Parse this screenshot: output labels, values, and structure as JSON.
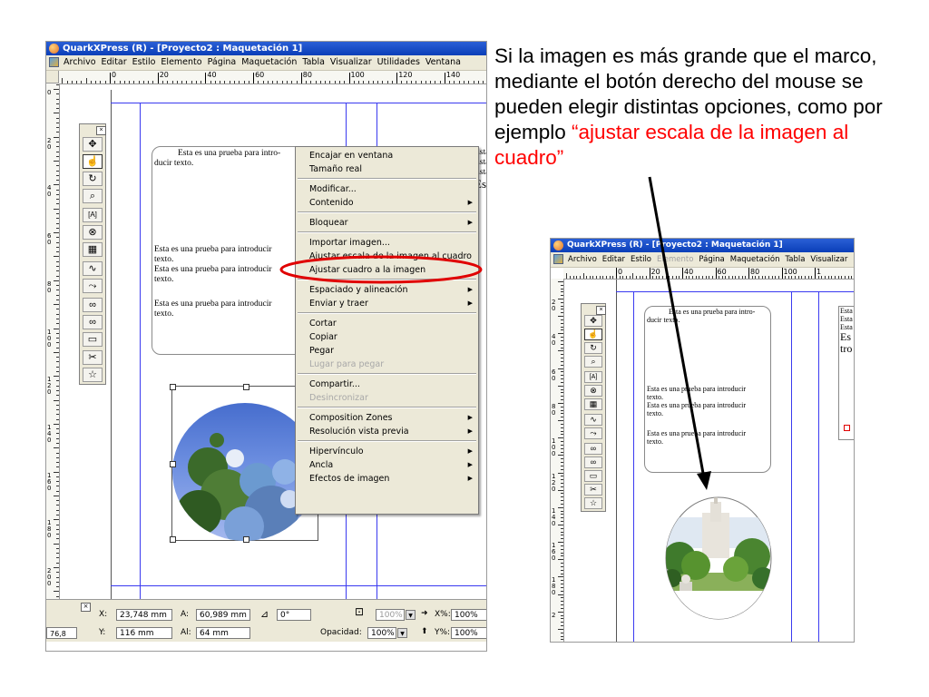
{
  "window": {
    "title": "QuarkXPress (R) - [Proyecto2 : Maquetación 1]"
  },
  "menubar": [
    "Archivo",
    "Editar",
    "Estilo",
    "Elemento",
    "Página",
    "Maquetación",
    "Tabla",
    "Visualizar",
    "Utilidades",
    "Ventana"
  ],
  "menubar_second": [
    "Archivo",
    "Editar",
    "Estilo",
    "Elemento",
    "Página",
    "Maquetación",
    "Tabla",
    "Visualizar"
  ],
  "ruler": {
    "h_labels": [
      "0",
      "20",
      "40",
      "60",
      "80",
      "100",
      "120",
      "140"
    ],
    "v_labels": [
      "0",
      "2 0",
      "4 0",
      "6 0",
      "8 0",
      "1 0 0",
      "1 2 0",
      "1 4 0",
      "1 6 0",
      "1 8 0",
      "2 0 0",
      "2"
    ],
    "h_labels_second": [
      "0",
      "20",
      "40",
      "60",
      "80",
      "100",
      "1"
    ],
    "v_labels_second": [
      "2 0",
      "4 0",
      "6 0",
      "8 0",
      "1 0 0",
      "1 2 0",
      "1 4 0",
      "1 6 0",
      "1 8 0",
      "2"
    ]
  },
  "document": {
    "para1": [
      "Esta es una prueba para intro-",
      "ducir texto."
    ],
    "para2": [
      "Esta es una prueba para introducir",
      "texto."
    ],
    "para3": [
      "Esta es una prueba para introducir",
      "texto."
    ],
    "para4": [
      "Esta es una prueba para introducir",
      "texto."
    ],
    "right_col": [
      "Esta",
      "Esta",
      "Esta",
      "Es",
      "tro"
    ]
  },
  "context_menu": {
    "groups": [
      [
        {
          "label": "Encajar en ventana"
        },
        {
          "label": "Tamaño real"
        }
      ],
      [
        {
          "label": "Modificar..."
        },
        {
          "label": "Contenido",
          "submenu": true
        }
      ],
      [
        {
          "label": "Bloquear",
          "submenu": true
        }
      ],
      [
        {
          "label": "Importar imagen..."
        },
        {
          "label": "Ajustar escala de la imagen al cuadro"
        },
        {
          "label": "Ajustar cuadro a la imagen"
        }
      ],
      [
        {
          "label": "Espaciado y alineación",
          "submenu": true
        },
        {
          "label": "Enviar y traer",
          "submenu": true
        }
      ],
      [
        {
          "label": "Cortar"
        },
        {
          "label": "Copiar"
        },
        {
          "label": "Pegar"
        },
        {
          "label": "Lugar para pegar",
          "disabled": true
        }
      ],
      [
        {
          "label": "Compartir..."
        },
        {
          "label": "Desincronizar",
          "disabled": true
        }
      ],
      [
        {
          "label": "Composition Zones",
          "submenu": true
        },
        {
          "label": "Resolución vista previa",
          "submenu": true
        }
      ],
      [
        {
          "label": "Hipervínculo",
          "submenu": true
        },
        {
          "label": "Ancla",
          "submenu": true
        },
        {
          "label": "Efectos de imagen",
          "submenu": true
        }
      ]
    ],
    "highlight_color": "#e00000"
  },
  "measurements": {
    "x_label": "X:",
    "x_value": "23,748 mm",
    "y_label": "Y:",
    "y_value": "116 mm",
    "w_label": "A:",
    "w_value": "60,989 mm",
    "h_label": "Al:",
    "h_value": "64 mm",
    "angle_value": "0°",
    "scale_value": "100%",
    "opacity_label": "Opacidad:",
    "opacity_value": "100%",
    "xscale_label": "X%:",
    "xscale_value": "100%",
    "yscale_label": "Y%:",
    "yscale_value": "100%",
    "zoom": "76,8"
  },
  "caption": {
    "text": "Si la imagen es más grande que el marco, mediante el botón derecho del mouse se pueden elegir distintas opciones, como por ejemplo ",
    "highlight": "“ajustar escala de la imagen al cuadro”"
  },
  "colors": {
    "titlebar": "#0b3fb8",
    "guides": "#3a3af0",
    "annotation_red": "#e00000",
    "caption_red": "#ff0000"
  }
}
